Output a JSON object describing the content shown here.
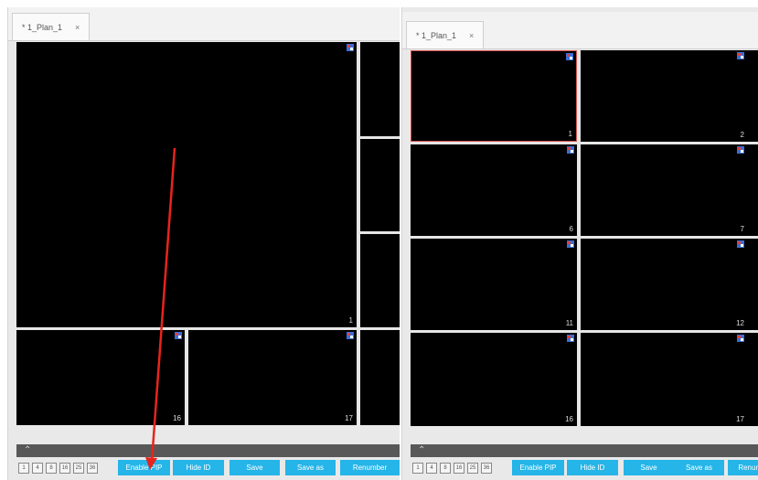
{
  "left_panel": {
    "tab": {
      "label": "* 1_Plan_1",
      "close": "×"
    },
    "tile_numbers": {
      "main": "1",
      "t16": "16",
      "t17": "17"
    },
    "collapse_icon": "chevron-double-up-icon",
    "layout_buttons": [
      "1",
      "4",
      "8",
      "16",
      "25",
      "36"
    ],
    "buttons": {
      "enable_pip": "Enable PIP",
      "hide_id": "Hide ID",
      "save": "Save",
      "save_as": "Save as",
      "renumber": "Renumber"
    }
  },
  "right_panel": {
    "tab": {
      "label": "* 1_Plan_1",
      "close": "×"
    },
    "tile_numbers": [
      "1",
      "2",
      "6",
      "7",
      "11",
      "12",
      "16",
      "17"
    ],
    "collapse_icon": "chevron-double-up-icon",
    "layout_buttons": [
      "1",
      "4",
      "8",
      "16",
      "25",
      "36"
    ],
    "buttons": {
      "enable_pip": "Enable PIP",
      "hide_id": "Hide ID",
      "save": "Save",
      "save_as": "Save as",
      "renumber": "Renumber"
    }
  },
  "colors": {
    "accent": "#25b5e8",
    "selected_border": "#d9534f",
    "annotation_arrow": "#e8241c",
    "tile_bg": "#000000",
    "collapse_bar": "#585858"
  }
}
